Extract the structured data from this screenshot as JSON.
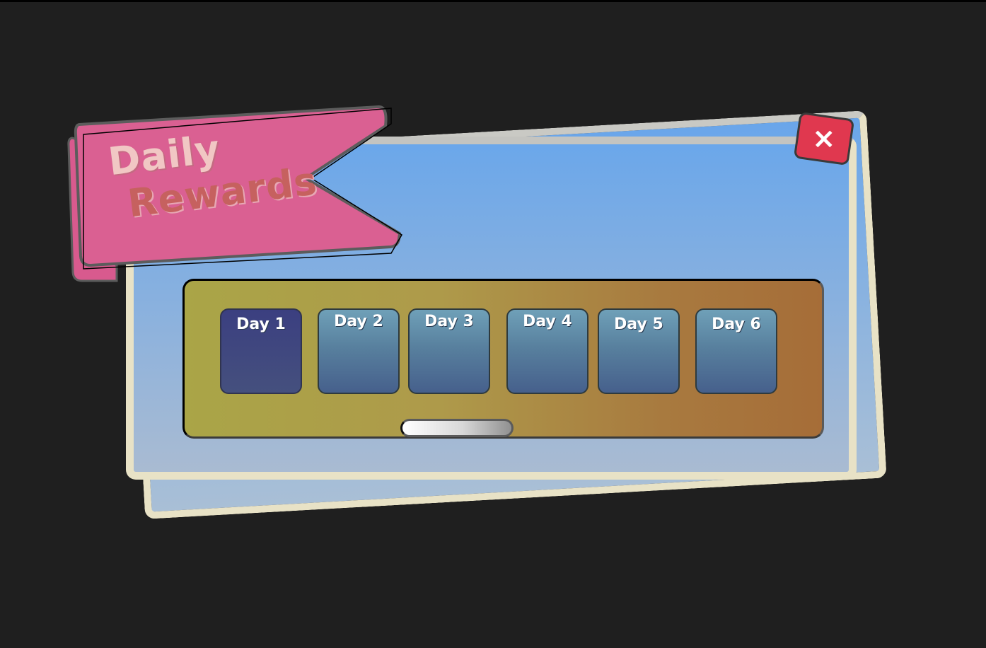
{
  "title": {
    "line1": "Daily",
    "line2": "Rewards"
  },
  "close_button": {
    "label": "×"
  },
  "days": [
    {
      "label": "Day 1",
      "selected": true
    },
    {
      "label": "Day 2",
      "selected": false
    },
    {
      "label": "Day 3",
      "selected": false
    },
    {
      "label": "Day 4",
      "selected": false
    },
    {
      "label": "Day 5",
      "selected": false
    },
    {
      "label": "Day 6",
      "selected": false
    }
  ],
  "colors": {
    "background": "#1f1f1f",
    "panel_top": "#6ba7ea",
    "panel_bottom": "#a9bbd2",
    "panel_border": "#e8e2c6",
    "ribbon": "#da6092",
    "close_button": "#e0384f",
    "tray_left": "#aaa547",
    "tray_right": "#a66d38",
    "day_card": "#5a82a0",
    "day_card_selected": "#3b3f80"
  },
  "icons": {
    "close": "close-icon"
  }
}
